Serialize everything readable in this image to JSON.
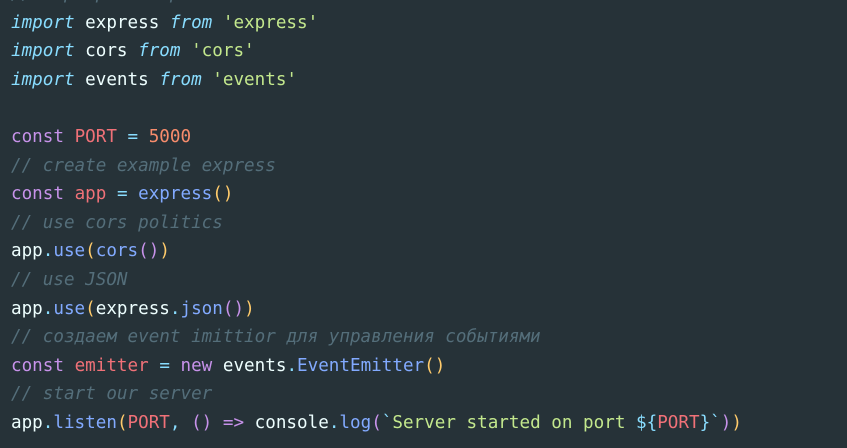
{
  "editor": {
    "background": "#263238",
    "lines": [
      [
        {
          "t": "// сервер на express",
          "c": "#546e7a",
          "s": "comment"
        }
      ],
      [
        {
          "t": "import",
          "c": "#89ddff",
          "s": "italic"
        },
        {
          "t": " express ",
          "c": "#eeffff"
        },
        {
          "t": "from",
          "c": "#89ddff",
          "s": "italic"
        },
        {
          "t": " ",
          "c": "#eeffff"
        },
        {
          "t": "'express'",
          "c": "#c3e88d"
        }
      ],
      [
        {
          "t": "import",
          "c": "#89ddff",
          "s": "italic"
        },
        {
          "t": " cors ",
          "c": "#eeffff"
        },
        {
          "t": "from",
          "c": "#89ddff",
          "s": "italic"
        },
        {
          "t": " ",
          "c": "#eeffff"
        },
        {
          "t": "'cors'",
          "c": "#c3e88d"
        }
      ],
      [
        {
          "t": "import",
          "c": "#89ddff",
          "s": "italic"
        },
        {
          "t": " events ",
          "c": "#eeffff"
        },
        {
          "t": "from",
          "c": "#89ddff",
          "s": "italic"
        },
        {
          "t": " ",
          "c": "#eeffff"
        },
        {
          "t": "'events'",
          "c": "#c3e88d"
        }
      ],
      [],
      [
        {
          "t": "const",
          "c": "#c792ea"
        },
        {
          "t": " ",
          "c": "#eeffff"
        },
        {
          "t": "PORT",
          "c": "#f07178"
        },
        {
          "t": " ",
          "c": "#eeffff"
        },
        {
          "t": "=",
          "c": "#89ddff"
        },
        {
          "t": " ",
          "c": "#eeffff"
        },
        {
          "t": "5000",
          "c": "#f78c6c"
        }
      ],
      [
        {
          "t": "// create example express",
          "c": "#546e7a",
          "s": "comment"
        }
      ],
      [
        {
          "t": "const",
          "c": "#c792ea"
        },
        {
          "t": " ",
          "c": "#eeffff"
        },
        {
          "t": "app",
          "c": "#f07178"
        },
        {
          "t": " ",
          "c": "#eeffff"
        },
        {
          "t": "=",
          "c": "#89ddff"
        },
        {
          "t": " ",
          "c": "#eeffff"
        },
        {
          "t": "express",
          "c": "#82aaff"
        },
        {
          "t": "()",
          "c": "#ffcb6b"
        }
      ],
      [
        {
          "t": "// use cors politics",
          "c": "#546e7a",
          "s": "comment"
        }
      ],
      [
        {
          "t": "app",
          "c": "#eeffff"
        },
        {
          "t": ".",
          "c": "#89ddff"
        },
        {
          "t": "use",
          "c": "#82aaff"
        },
        {
          "t": "(",
          "c": "#ffcb6b"
        },
        {
          "t": "cors",
          "c": "#82aaff"
        },
        {
          "t": "()",
          "c": "#c792ea"
        },
        {
          "t": ")",
          "c": "#ffcb6b"
        }
      ],
      [
        {
          "t": "// use JSON",
          "c": "#546e7a",
          "s": "comment"
        }
      ],
      [
        {
          "t": "app",
          "c": "#eeffff"
        },
        {
          "t": ".",
          "c": "#89ddff"
        },
        {
          "t": "use",
          "c": "#82aaff"
        },
        {
          "t": "(",
          "c": "#ffcb6b"
        },
        {
          "t": "express",
          "c": "#eeffff"
        },
        {
          "t": ".",
          "c": "#89ddff"
        },
        {
          "t": "json",
          "c": "#82aaff"
        },
        {
          "t": "()",
          "c": "#c792ea"
        },
        {
          "t": ")",
          "c": "#ffcb6b"
        }
      ],
      [
        {
          "t": "// создаем event imittior для управления событиями",
          "c": "#546e7a",
          "s": "comment"
        }
      ],
      [
        {
          "t": "const",
          "c": "#c792ea"
        },
        {
          "t": " ",
          "c": "#eeffff"
        },
        {
          "t": "emitter",
          "c": "#f07178"
        },
        {
          "t": " ",
          "c": "#eeffff"
        },
        {
          "t": "=",
          "c": "#89ddff"
        },
        {
          "t": " ",
          "c": "#eeffff"
        },
        {
          "t": "new",
          "c": "#c792ea"
        },
        {
          "t": " events",
          "c": "#eeffff"
        },
        {
          "t": ".",
          "c": "#89ddff"
        },
        {
          "t": "EventEmitter",
          "c": "#82aaff"
        },
        {
          "t": "()",
          "c": "#ffcb6b"
        }
      ],
      [
        {
          "t": "// start our server",
          "c": "#546e7a",
          "s": "comment"
        }
      ],
      [
        {
          "t": "app",
          "c": "#eeffff"
        },
        {
          "t": ".",
          "c": "#89ddff"
        },
        {
          "t": "listen",
          "c": "#82aaff"
        },
        {
          "t": "(",
          "c": "#ffcb6b"
        },
        {
          "t": "PORT",
          "c": "#f07178"
        },
        {
          "t": ", ",
          "c": "#89ddff"
        },
        {
          "t": "()",
          "c": "#c792ea"
        },
        {
          "t": " ",
          "c": "#eeffff"
        },
        {
          "t": "=>",
          "c": "#c792ea"
        },
        {
          "t": " console",
          "c": "#eeffff"
        },
        {
          "t": ".",
          "c": "#89ddff"
        },
        {
          "t": "log",
          "c": "#82aaff"
        },
        {
          "t": "(",
          "c": "#c792ea"
        },
        {
          "t": "`",
          "c": "#89ddff"
        },
        {
          "t": "Server started on port ",
          "c": "#c3e88d"
        },
        {
          "t": "${",
          "c": "#89ddff"
        },
        {
          "t": "PORT",
          "c": "#f07178"
        },
        {
          "t": "}",
          "c": "#89ddff"
        },
        {
          "t": "`",
          "c": "#89ddff"
        },
        {
          "t": ")",
          "c": "#c792ea"
        },
        {
          "t": ")",
          "c": "#ffcb6b"
        }
      ]
    ]
  }
}
